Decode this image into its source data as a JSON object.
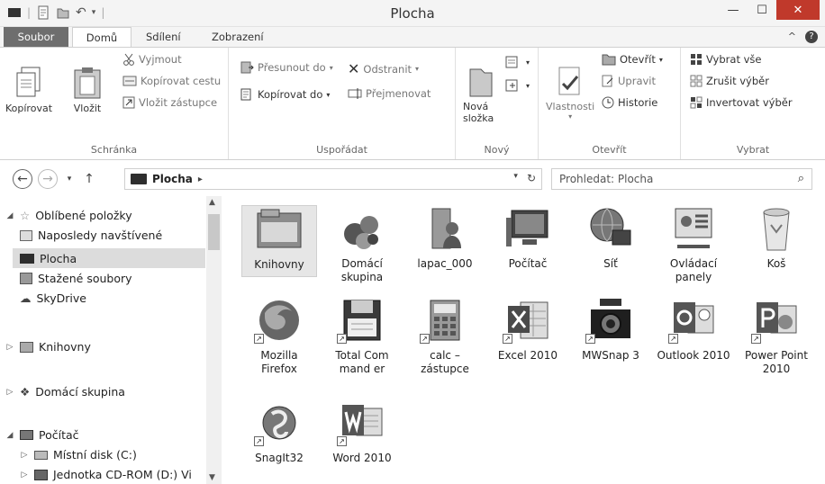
{
  "window": {
    "title": "Plocha"
  },
  "ribbon_tabs": [
    "Soubor",
    "Domů",
    "Sdílení",
    "Zobrazení"
  ],
  "clipboard": {
    "copy": "Kopírovat",
    "paste": "Vložit",
    "cut": "Vyjmout",
    "copy_path": "Kopírovat cestu",
    "paste_shortcut": "Vložit zástupce",
    "group": "Schránka"
  },
  "organize": {
    "move_to": "Přesunout do",
    "copy_to": "Kopírovat do",
    "delete": "Odstranit",
    "rename": "Přejmenovat",
    "group": "Uspořádat"
  },
  "new": {
    "new_folder": "Nová složka",
    "group": "Nový"
  },
  "open": {
    "properties": "Vlastnosti",
    "open": "Otevřít",
    "edit": "Upravit",
    "history": "Historie",
    "group": "Otevřít"
  },
  "select": {
    "select_all": "Vybrat vše",
    "select_none": "Zrušit výběr",
    "invert": "Invertovat výběr",
    "group": "Vybrat"
  },
  "address": {
    "location": "Plocha",
    "search_placeholder": "Prohledat: Plocha"
  },
  "nav_pane": {
    "favorites": "Oblíbené položky",
    "recent": "Naposledy navštívené",
    "desktop": "Plocha",
    "downloads": "Stažené soubory",
    "skydrive": "SkyDrive",
    "libraries": "Knihovny",
    "homegroup": "Domácí skupina",
    "computer": "Počítač",
    "local_disk": "Místní disk (C:)",
    "cdrom": "Jednotka CD-ROM (D:) Vi"
  },
  "files": [
    "Knihovny",
    "Domácí skupina",
    "lapac_000",
    "Počítač",
    "Síť",
    "Ovládací panely",
    "Koš",
    "Mozilla Firefox",
    "Total Command er",
    "calc – zástupce",
    "Excel 2010",
    "MWSnap 3",
    "Outlook 2010",
    "Power Point 2010",
    "SnagIt32",
    "Word 2010"
  ]
}
